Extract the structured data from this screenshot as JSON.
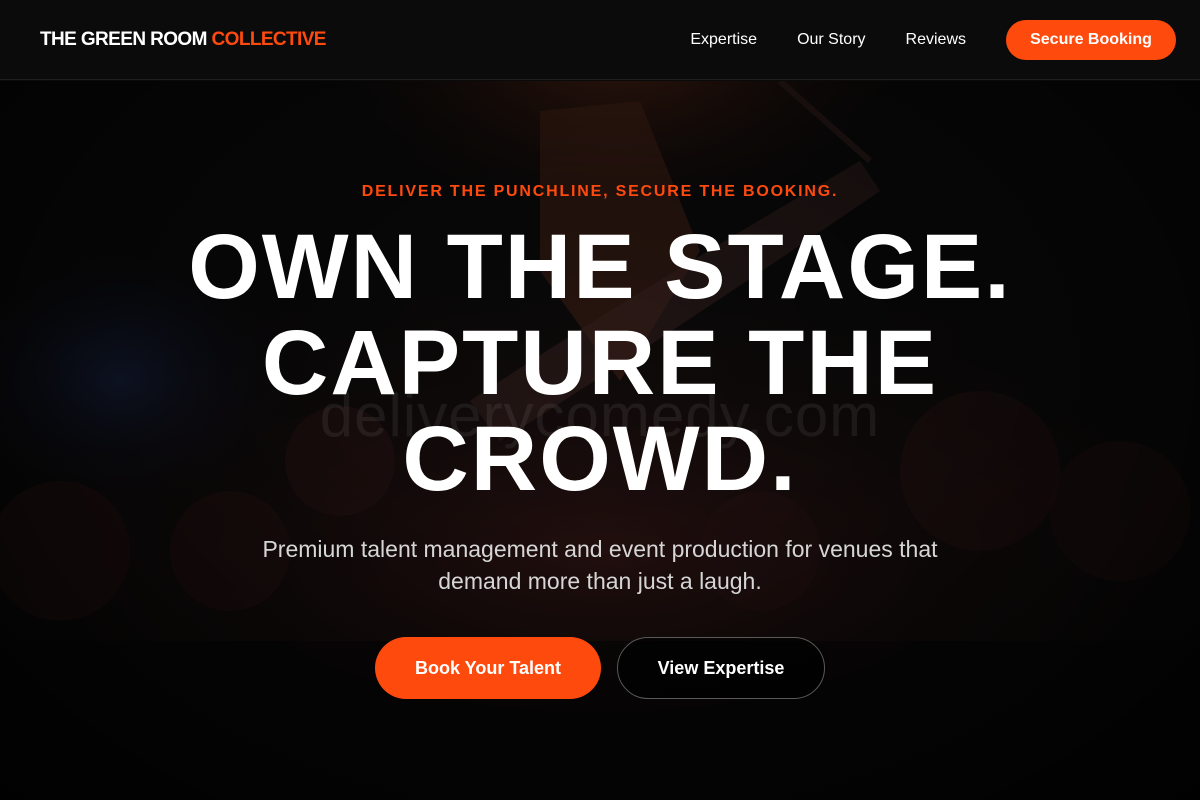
{
  "header": {
    "logo_main": "THE GREEN ROOM",
    "logo_accent": "COLLECTIVE",
    "nav": [
      "Expertise",
      "Our Story",
      "Reviews"
    ],
    "cta_label": "Secure Booking"
  },
  "hero": {
    "eyebrow": "DELIVER THE PUNCHLINE, SECURE THE BOOKING.",
    "headline": "OWN THE STAGE. CAPTURE THE CROWD.",
    "subtext": "Premium talent management and event production for venues that demand more than just a laugh.",
    "primary_button": "Book Your Talent",
    "secondary_button": "View Expertise",
    "watermark": "deliverycomedy.com"
  },
  "colors": {
    "accent": "#ff4a0e",
    "background": "#0a0a0a",
    "text": "#ffffff",
    "muted_text": "#d6d6d6"
  }
}
